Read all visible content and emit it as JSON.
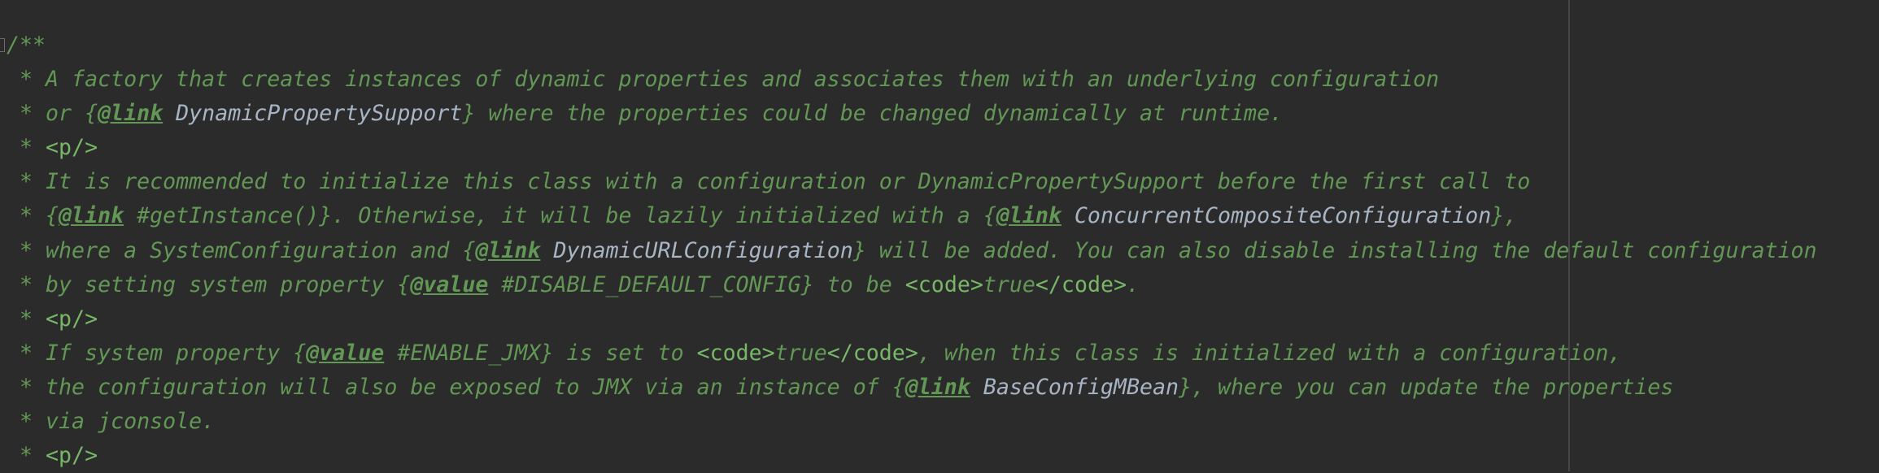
{
  "editor": {
    "colors": {
      "background": "#2b2b2b",
      "comment": "#629755",
      "reference": "#a8b5c4",
      "markup": "#77b767",
      "right_margin": "#474747"
    },
    "lines": [
      [
        [
          "c",
          "/**"
        ]
      ],
      [
        [
          "c",
          " * A factory that creates instances of dynamic properties and associates them with an underlying configuration"
        ]
      ],
      [
        [
          "c",
          " * or {"
        ],
        [
          "tag",
          "@link"
        ],
        [
          "c",
          " "
        ],
        [
          "ref",
          "DynamicPropertySupport"
        ],
        [
          "c",
          "} where the properties could be changed dynamically at runtime."
        ]
      ],
      [
        [
          "c",
          " * "
        ],
        [
          "m",
          "<p/>"
        ]
      ],
      [
        [
          "c",
          " * It is recommended to initialize this class with a configuration or DynamicPropertySupport before the first call to"
        ]
      ],
      [
        [
          "c",
          " * {"
        ],
        [
          "tag",
          "@link"
        ],
        [
          "c",
          " #getInstance()}. Otherwise, it will be lazily initialized with a {"
        ],
        [
          "tag",
          "@link"
        ],
        [
          "c",
          " "
        ],
        [
          "ref",
          "ConcurrentCompositeConfiguration"
        ],
        [
          "c",
          "},"
        ]
      ],
      [
        [
          "c",
          " * where a SystemConfiguration and {"
        ],
        [
          "tag",
          "@link"
        ],
        [
          "c",
          " "
        ],
        [
          "ref",
          "DynamicURLConfiguration"
        ],
        [
          "c",
          "} will be added. You can also disable installing the default configuration"
        ]
      ],
      [
        [
          "c",
          " * by setting system property {"
        ],
        [
          "tag",
          "@value"
        ],
        [
          "c",
          " #DISABLE_DEFAULT_CONFIG} to be "
        ],
        [
          "m",
          "<code>"
        ],
        [
          "c",
          "true"
        ],
        [
          "m",
          "</code>"
        ],
        [
          "c",
          "."
        ]
      ],
      [
        [
          "c",
          " * "
        ],
        [
          "m",
          "<p/>"
        ]
      ],
      [
        [
          "c",
          " * If system property {"
        ],
        [
          "tag",
          "@value"
        ],
        [
          "c",
          " #ENABLE_JMX} is set to "
        ],
        [
          "m",
          "<code>"
        ],
        [
          "c",
          "true"
        ],
        [
          "m",
          "</code>"
        ],
        [
          "c",
          ", when this class is initialized with a configuration,"
        ]
      ],
      [
        [
          "c",
          " * the configuration will also be exposed to JMX via an instance of {"
        ],
        [
          "tag",
          "@link"
        ],
        [
          "c",
          " "
        ],
        [
          "ref",
          "BaseConfigMBean"
        ],
        [
          "c",
          "}, where you can update the properties"
        ]
      ],
      [
        [
          "c",
          " * via jconsole."
        ]
      ],
      [
        [
          "c",
          " * "
        ],
        [
          "m",
          "<p/>"
        ]
      ]
    ]
  }
}
